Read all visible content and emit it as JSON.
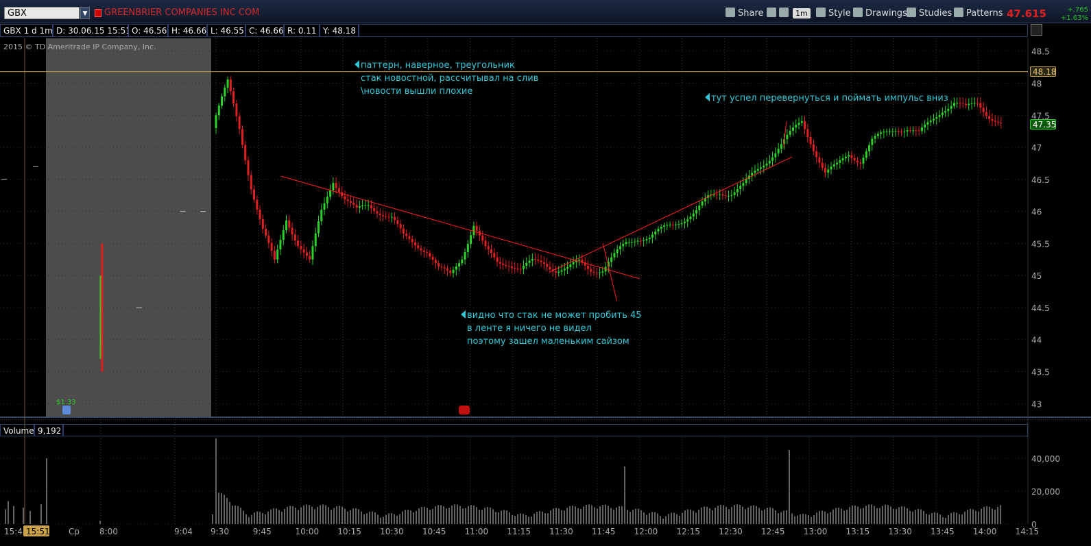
{
  "toolbar": {
    "symbol": "GBX",
    "company": "GREENBRIER COMPANIES INC COM",
    "share": "Share",
    "timeframe": "1m",
    "style": "Style",
    "drawings": "Drawings",
    "studies": "Studies",
    "patterns": "Patterns",
    "last_price": "47.615",
    "net_change": "+.765",
    "pct_change": "+1.63%",
    "icons": [
      "share-icon",
      "wrench-icon",
      "tool-icon",
      "style-icon",
      "pencil-icon",
      "studies-icon",
      "patterns-icon"
    ]
  },
  "info": {
    "title": "GBX 1 d 1m",
    "date": "D: 30.06.15 15:51",
    "open": "O: 46.56",
    "high": "H: 46.66",
    "low": "L: 46.55",
    "close": "C: 46.66",
    "range": "R: 0.11",
    "y": "Y: 48.18"
  },
  "copyright": "2015 © TD Ameritrade IP Company, Inc.",
  "annotations": {
    "a1": [
      "паттерн, наверное, треугольник",
      "стак новостной, рассчитывал на слив",
      "\\новости вышли плохие"
    ],
    "a2": [
      "тут успел перевернуться и поймать импульс вниз"
    ],
    "a3": [
      "видно что стак не может пробить 45",
      "в ленте я ничего не видел",
      "поэтому зашел маленьким сайзом"
    ]
  },
  "price_axis": [
    "48.5",
    "48",
    "47.5",
    "47",
    "46.5",
    "46",
    "45.5",
    "45",
    "44.5",
    "44",
    "43.5",
    "43"
  ],
  "price_tags": {
    "crosshair": "48.18",
    "last": "47.35"
  },
  "dividend_label": "$1.33",
  "volume": {
    "label": "Volume",
    "value": "9,192",
    "axis": [
      "40,000",
      "20,000",
      "0"
    ]
  },
  "time_axis": [
    "15:45",
    "15:51",
    "Ср",
    "8:00",
    "9:04",
    "9:30",
    "9:45",
    "10:00",
    "10:15",
    "10:30",
    "10:45",
    "11:00",
    "11:15",
    "11:30",
    "11:45",
    "12:00",
    "12:15",
    "12:30",
    "12:45",
    "13:00",
    "13:15",
    "13:30",
    "13:45",
    "14:00",
    "14:15"
  ],
  "colors": {
    "up": "#2ad22a",
    "down": "#e02020",
    "annotation": "#33c8d8",
    "trendline": "#ff2020",
    "volume": "#c8c8c8",
    "premarket": "#5a5a5a"
  },
  "chart_data": {
    "type": "candlestick",
    "ylim": [
      42.8,
      48.7
    ],
    "x_session_open": "9:30",
    "candles_premarket": [
      {
        "t": "15:45",
        "c": 46.5
      },
      {
        "t": "15:51",
        "c": 46.7
      },
      {
        "t": "8:00",
        "o": 43.7,
        "c": 45.0
      },
      {
        "t": "8:01",
        "o": 45.5,
        "c": 43.5
      },
      {
        "t": "8:30",
        "c": 44.5
      },
      {
        "t": "9:04",
        "c": 46.0
      },
      {
        "t": "9:20",
        "c": 46.0
      }
    ],
    "session_close_series": [
      47.5,
      48.0,
      47.3,
      46.4,
      45.7,
      45.2,
      45.9,
      45.5,
      45.2,
      46.0,
      46.5,
      46.2,
      46.0,
      46.1,
      46.0,
      45.9,
      45.6,
      45.5,
      45.4,
      45.1,
      45.0,
      45.3,
      45.8,
      45.4,
      45.2,
      45.2,
      45.1,
      45.2,
      45.2,
      45.1,
      45.1,
      45.2,
      45.1,
      45.1,
      45.3,
      45.5,
      45.6,
      45.6,
      45.7,
      45.8,
      45.9,
      46.0,
      46.2,
      46.3,
      46.3,
      46.4,
      46.6,
      46.8,
      47.0,
      47.2,
      47.4,
      47.0,
      46.6,
      46.7,
      46.9,
      46.8,
      47.1,
      47.2,
      47.3,
      47.3,
      47.2,
      47.4,
      47.6,
      47.7,
      47.6,
      47.7,
      47.5,
      47.35
    ],
    "volume_peaks": [
      {
        "t": "9:30",
        "v": 52000
      },
      {
        "t": "11:55",
        "v": 35000
      },
      {
        "t": "12:53",
        "v": 45000
      }
    ],
    "trendlines": [
      {
        "from": [
          "9:53",
          46.55
        ],
        "to": [
          "12:00",
          44.95
        ]
      },
      {
        "from": [
          "11:28",
          45.05
        ],
        "to": [
          "12:54",
          46.85
        ]
      }
    ]
  }
}
